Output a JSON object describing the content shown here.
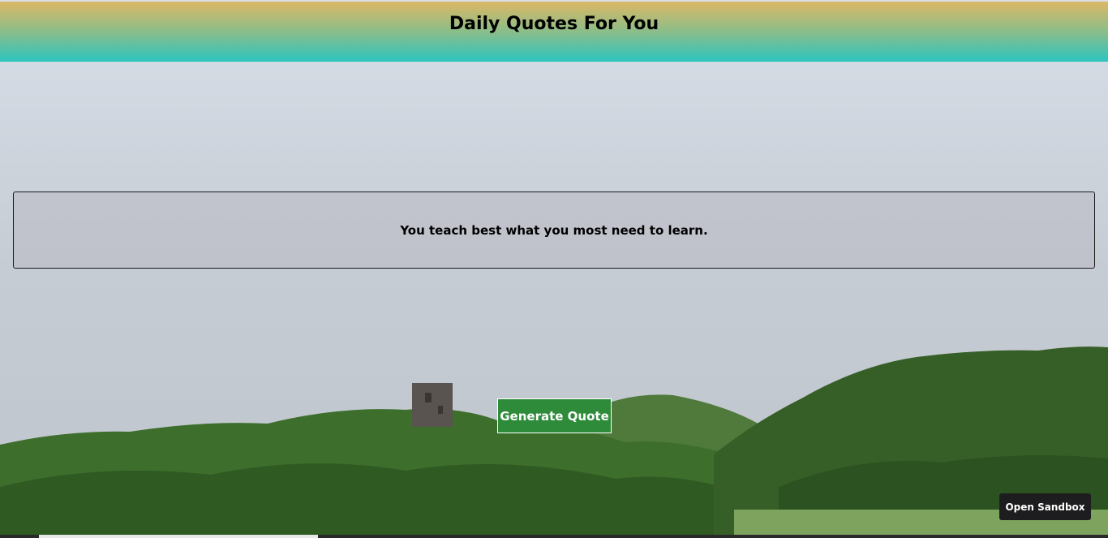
{
  "header": {
    "title": "Daily Quotes For You"
  },
  "quote": {
    "text": "You teach best what you most need to learn."
  },
  "actions": {
    "generate_label": "Generate Quote",
    "sandbox_label": "Open Sandbox"
  },
  "colors": {
    "header_top": "#dcb765",
    "header_bottom": "#2cc4bf",
    "generate_button": "#2e8b3a",
    "sandbox_button": "#1d1d1f"
  }
}
